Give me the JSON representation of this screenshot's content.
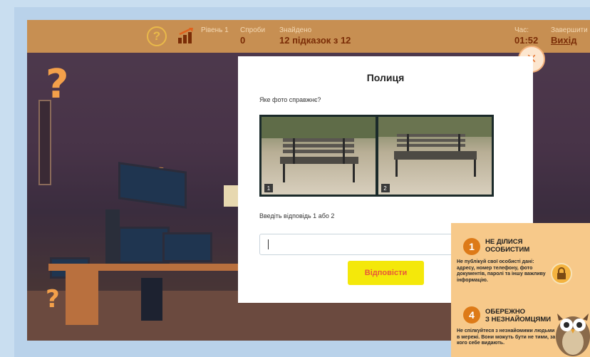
{
  "header": {
    "help_icon": "?",
    "level_label": "Рівень 1",
    "attempts_label": "Спроби",
    "attempts_value": "0",
    "found_label": "Знайдено",
    "found_value": "12 підказок з 12",
    "time_label": "Час:",
    "time_value": "01:52",
    "finish_label": "Завершити",
    "exit_link": "Вихід"
  },
  "modal": {
    "close_icon": "×",
    "title": "Полиця",
    "question": "Яке фото справжнє?",
    "photos": [
      {
        "number": "1"
      },
      {
        "number": "2"
      }
    ],
    "prompt": "Введіть відповідь 1 або 2",
    "answer_value": "",
    "submit_label": "Відповісти"
  },
  "tips": [
    {
      "number": "1",
      "title_line1": "НЕ ДІЛИСЯ",
      "title_line2": "ОСОБИСТИМ",
      "text": "Не публікуй свої особисті дані: адресу, номер телефону, фото документів, паролі та іншу важливу інформацію."
    },
    {
      "number": "4",
      "title_line1": "ОБЕРЕЖНО",
      "title_line2": "З НЕЗНАЙОМЦЯМИ",
      "text": "Не спілкуйтеся з незнайомими людьми в мережі. Вони можуть бути не тими, за кого себе видають."
    }
  ],
  "colors": {
    "accent_orange": "#f3a04a",
    "submit_yellow": "#f4e80a",
    "topbar": "#c78f52",
    "header_value": "#7a2c06"
  },
  "icons": [
    "help-icon",
    "level-bars-icon",
    "close-icon",
    "lock-icon",
    "owl-mascot"
  ]
}
